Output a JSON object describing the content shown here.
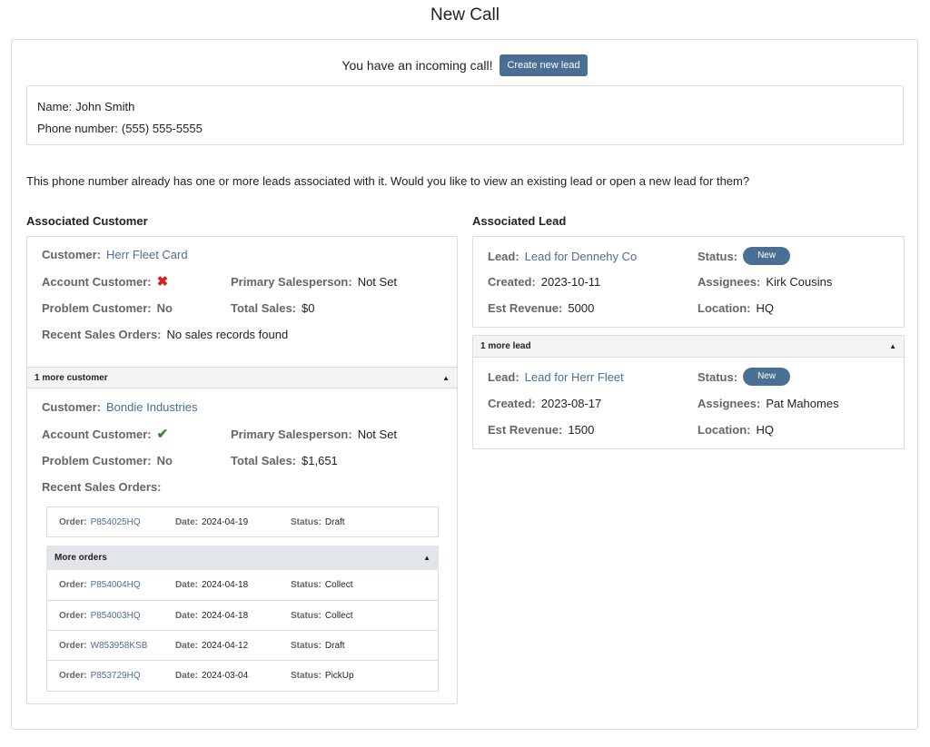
{
  "page": {
    "title": "New Call"
  },
  "incoming": {
    "text": "You have an incoming call!",
    "create_button": "Create new lead"
  },
  "caller": {
    "name_label": "Name:",
    "name_value": "John Smith",
    "phone_label": "Phone number:",
    "phone_value": "(555) 555-5555"
  },
  "notice": "This phone number already has one or more leads associated with it. Would you like to view an existing lead or open a new lead for them?",
  "customer_section": {
    "title": "Associated Customer",
    "primary": {
      "customer_label": "Customer:",
      "customer_value": "Herr Fleet Card",
      "account_label": "Account Customer:",
      "account_icon": "x-icon",
      "salesperson_label": "Primary Salesperson:",
      "salesperson_value": "Not Set",
      "problem_label": "Problem Customer:",
      "problem_value": "No",
      "sales_label": "Total Sales:",
      "sales_value": "$0",
      "orders_label": "Recent Sales Orders:",
      "orders_value": "No sales records found"
    },
    "more_header": "1 more customer",
    "secondary": {
      "customer_label": "Customer:",
      "customer_value": "Bondie Industries",
      "account_label": "Account Customer:",
      "account_icon": "check-icon",
      "salesperson_label": "Primary Salesperson:",
      "salesperson_value": "Not Set",
      "problem_label": "Problem Customer:",
      "problem_value": "No",
      "sales_label": "Total Sales:",
      "sales_value": "$1,651",
      "orders_label": "Recent Sales Orders:",
      "first_order": {
        "order": "P854025HQ",
        "date": "2024-04-19",
        "status": "Draft"
      },
      "more_orders_header": "More orders",
      "more_orders": [
        {
          "order": "P854004HQ",
          "date": "2024-04-18",
          "status": "Collect"
        },
        {
          "order": "P854003HQ",
          "date": "2024-04-18",
          "status": "Collect"
        },
        {
          "order": "W853958KSB",
          "date": "2024-04-12",
          "status": "Draft"
        },
        {
          "order": "P853729HQ",
          "date": "2024-03-04",
          "status": "PickUp"
        }
      ],
      "order_label": "Order:",
      "date_label": "Date:",
      "status_label": "Status:"
    }
  },
  "lead_section": {
    "title": "Associated Lead",
    "primary": {
      "lead_label": "Lead:",
      "lead_value": "Lead for Dennehy Co",
      "status_label": "Status:",
      "status_value": "New",
      "created_label": "Created:",
      "created_value": "2023-10-11",
      "assignees_label": "Assignees:",
      "assignees_value": "Kirk Cousins",
      "revenue_label": "Est Revenue:",
      "revenue_value": "5000",
      "location_label": "Location:",
      "location_value": "HQ"
    },
    "more_header": "1 more lead",
    "secondary": {
      "lead_label": "Lead:",
      "lead_value": "Lead for Herr Fleet",
      "status_label": "Status:",
      "status_value": "New",
      "created_label": "Created:",
      "created_value": "2023-08-17",
      "assignees_label": "Assignees:",
      "assignees_value": "Pat Mahomes",
      "revenue_label": "Est Revenue:",
      "revenue_value": "1500",
      "location_label": "Location:",
      "location_value": "HQ"
    }
  },
  "colors": {
    "accent": "#4a6f95",
    "error": "#d92020",
    "success": "#2f8f2f"
  }
}
